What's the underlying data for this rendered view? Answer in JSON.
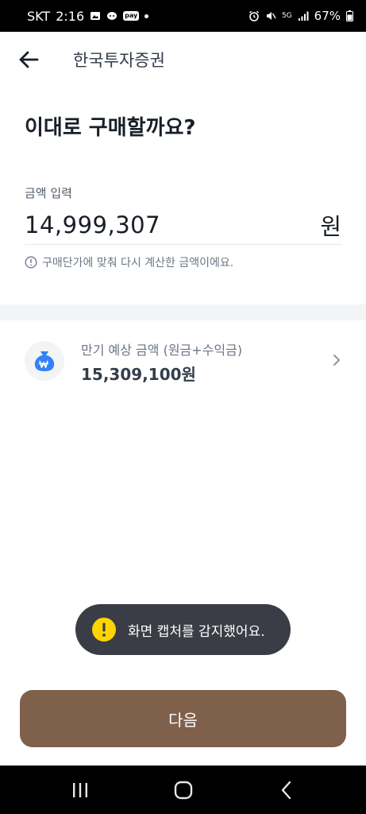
{
  "status_bar": {
    "carrier": "SKT",
    "time": "2:16",
    "pay_badge": "pay",
    "network_badge": "5G",
    "battery": "67%"
  },
  "header": {
    "title": "한국투자증권",
    "back_icon": "arrow-left-icon"
  },
  "page": {
    "title": "이대로 구매할까요?"
  },
  "amount": {
    "label": "금액 입력",
    "value": "14,999,307",
    "unit": "원",
    "notice": "구매단가에 맞춰 다시 계산한 금액이에요.",
    "notice_icon": "info-circle-icon"
  },
  "maturity": {
    "label": "만기 예상 금액 (원금+수익금)",
    "value": "15,309,100원",
    "icon": "money-bag-won-icon"
  },
  "toast": {
    "text": "화면 캡처를 감지했어요.",
    "icon": "warning-icon"
  },
  "next_button": {
    "label": "다음"
  },
  "colors": {
    "accent_button": "#7f604b",
    "bag_blue": "#3182f6",
    "toast_bg": "#3a3d46",
    "warning_yellow": "#ffd400"
  }
}
